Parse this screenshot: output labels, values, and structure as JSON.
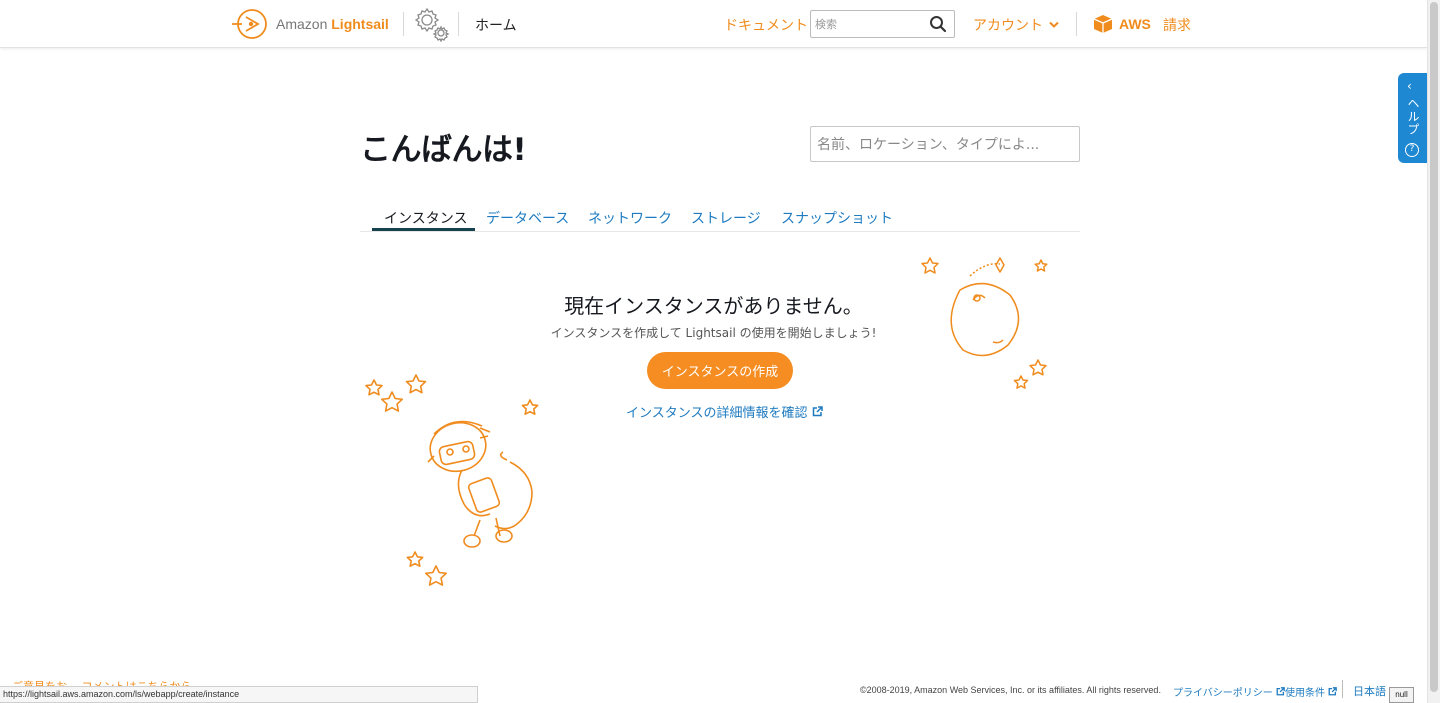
{
  "header": {
    "logo_prefix": "Amazon",
    "logo_brand": "Lightsail",
    "home_label": "ホーム",
    "docs_label": "ドキュメント",
    "search_placeholder": "検索",
    "account_label": "アカウント",
    "aws_label": "AWS",
    "billing_label": "請求"
  },
  "help_tab": {
    "label": "ヘルプ",
    "arrow": "‹",
    "question": "?"
  },
  "main": {
    "greeting": "こんばんは!",
    "filter_placeholder": "名前、ロケーション、タイプによ...",
    "tabs": [
      {
        "label": "インスタンス",
        "active": true
      },
      {
        "label": "データベース",
        "active": false
      },
      {
        "label": "ネットワーク",
        "active": false
      },
      {
        "label": "ストレージ",
        "active": false
      },
      {
        "label": "スナップショット",
        "active": false
      }
    ],
    "empty_title": "現在インスタンスがありません。",
    "empty_subtitle": "インスタンスを作成して Lightsail の使用を開始しましょう!",
    "create_button": "インスタンスの作成",
    "learn_link": "インスタンスの詳細情報を確認"
  },
  "footer": {
    "feedback": "ご意見をお… コメントはこちらから",
    "status_url": "https://lightsail.aws.amazon.com/ls/webapp/create/instance",
    "copyright": "©2008-2019, Amazon Web Services, Inc. or its affiliates. All rights reserved.",
    "privacy": "プライバシーポリシー",
    "terms": "使用条件",
    "language": "日本語",
    "null_box": "null"
  },
  "colors": {
    "brand_orange": "#f58d22",
    "link_blue": "#1e7bc0",
    "help_blue": "#1e88d2",
    "tab_underline": "#16414f"
  }
}
